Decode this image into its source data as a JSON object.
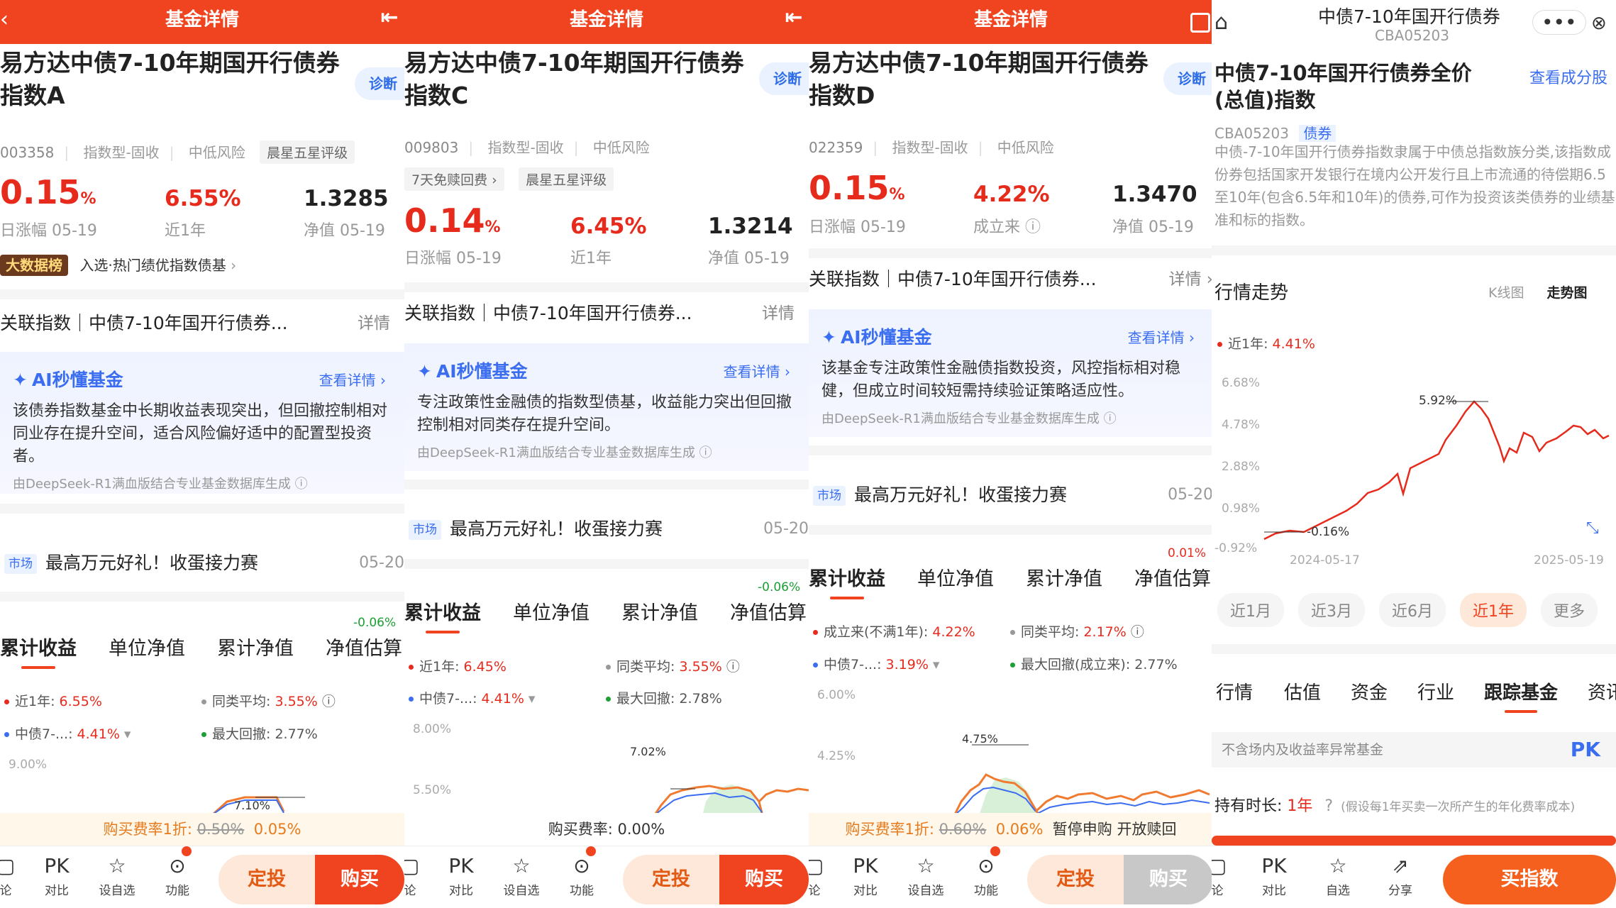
{
  "panels": [
    {
      "header": "基金详情",
      "fund_title": "易方达中债7-10年期国开行债券指数A",
      "diag": "诊断",
      "code": "003358",
      "type": "指数型-固收",
      "risk": "中低风险",
      "rating": "晨星五星评级",
      "daily_change": "0.15",
      "daily_label": "日涨幅 05-19",
      "ret": "6.55%",
      "ret_label": "近1年",
      "nav": "1.3285",
      "nav_label": "净值 05-19",
      "bigdata_badge": "大数据榜",
      "bigdata_text": "入选·热门绩优指数债基",
      "rel_index": "关联指数｜中债7-10年国开行债券...",
      "rel_detail": "详情",
      "ai_title": "AI秒懂基金",
      "ai_more": "查看详情 ›",
      "ai_text": "该债券指数基金中长期收益表现突出，但回撤控制相对同业存在提升空间，适合风险偏好适中的配置型投资者。",
      "ai_src": "由DeepSeek-R1满血版结合专业基金数据库生成 ⓘ",
      "mkt_badge": "市场",
      "mkt_text": "最高万元好礼！收蛋接力赛",
      "mkt_date": "05-20",
      "tabs": [
        "累计收益",
        "单位净值",
        "累计净值",
        "净值估算"
      ],
      "est_change": "-0.06%",
      "leg1": "近1年: ",
      "leg1v": "6.55%",
      "leg2": "同类平均: ",
      "leg2v": "3.55%",
      "leg3": "中债7-...: ",
      "leg3v": "4.41%",
      "leg4": "最大回撤: ",
      "leg4v": "2.77%",
      "ytop": "9.00%",
      "peak": "7.10%",
      "fee_label": "购买费率1折: ",
      "fee_old": "0.50%",
      "fee_new": "0.05%",
      "foot": [
        "论",
        "对比",
        "设自选",
        "功能"
      ],
      "btn1": "定投",
      "btn2": "购买"
    },
    {
      "header": "基金详情",
      "fund_title": "易方达中债7-10年期国开行债券指数C",
      "diag": "诊断",
      "code": "009803",
      "type": "指数型-固收",
      "risk": "中低风险",
      "tag1": "7天免赎回费 ›",
      "rating": "晨星五星评级",
      "daily_change": "0.14",
      "daily_label": "日涨幅 05-19",
      "ret": "6.45%",
      "ret_label": "近1年",
      "nav": "1.3214",
      "nav_label": "净值 05-19",
      "rel_index": "关联指数｜中债7-10年国开行债券...",
      "rel_detail": "详情",
      "ai_title": "AI秒懂基金",
      "ai_more": "查看详情 ›",
      "ai_text": "专注政策性金融债的指数型债基，收益能力突出但回撤控制相对同类存在提升空间。",
      "ai_src": "由DeepSeek-R1满血版结合专业基金数据库生成 ⓘ",
      "mkt_badge": "市场",
      "mkt_text": "最高万元好礼！收蛋接力赛",
      "mkt_date": "05-20",
      "tabs": [
        "累计收益",
        "单位净值",
        "累计净值",
        "净值估算"
      ],
      "est_change": "-0.06%",
      "leg1": "近1年: ",
      "leg1v": "6.45%",
      "leg2": "同类平均: ",
      "leg2v": "3.55%",
      "leg3": "中债7-...: ",
      "leg3v": "4.41%",
      "leg4": "最大回撤: ",
      "leg4v": "2.78%",
      "ytop": "8.00%",
      "ymid": "5.50%",
      "peak": "7.02%",
      "fee_text": "购买费率: 0.00%",
      "foot": [
        "论",
        "对比",
        "设自选",
        "功能"
      ],
      "btn1": "定投",
      "btn2": "购买"
    },
    {
      "header": "基金详情",
      "fund_title": "易方达中债7-10年期国开行债券指数D",
      "diag": "诊断",
      "code": "022359",
      "type": "指数型-固收",
      "risk": "中低风险",
      "daily_change": "0.15",
      "daily_label": "日涨幅 05-19",
      "ret": "4.22%",
      "ret_label": "成立来 ⓘ",
      "nav": "1.3470",
      "nav_label": "净值 05-19",
      "rel_index": "关联指数｜中债7-10年国开行债券...",
      "rel_detail": "详情 ›",
      "ai_title": "AI秒懂基金",
      "ai_more": "查看详情 ›",
      "ai_text": "该基金专注政策性金融债指数投资，风控指标相对稳健，但成立时间较短需持续验证策略适应性。",
      "ai_src": "由DeepSeek-R1满血版结合专业基金数据库生成 ⓘ",
      "mkt_badge": "市场",
      "mkt_text": "最高万元好礼！收蛋接力赛",
      "mkt_date": "05-20",
      "tabs": [
        "累计收益",
        "单位净值",
        "累计净值",
        "净值估算"
      ],
      "est_change": "0.01%",
      "leg1": "成立来(不满1年): ",
      "leg1v": "4.22%",
      "leg2": "同类平均: ",
      "leg2v": "2.17%",
      "leg3": "中债7-...: ",
      "leg3v": "3.19%",
      "leg4": "最大回撤(成立来): ",
      "leg4v": "2.77%",
      "ytop": "6.00%",
      "ymid": "4.25%",
      "peak": "4.75%",
      "fee_label": "购买费率1折: ",
      "fee_old": "0.60%",
      "fee_new": "0.06%",
      "fee_extra": "暂停申购 开放赎回",
      "foot": [
        "论",
        "对比",
        "设自选",
        "功能"
      ],
      "btn1": "定投",
      "btn2": "购买"
    }
  ],
  "index_panel": {
    "top_title": "中债7-10年国开行债券",
    "top_code": "CBA05203",
    "name": "中债7-10年国开行债券全价(总值)指数",
    "view_components": "查看成分股",
    "code": "CBA05203",
    "tag": "债券",
    "desc": "中债-7-10年国开行债券指数隶属于中债总指数族分类,该指数成份券包括国家开发银行在境内公开发行且上市流通的待偿期6.5至10年(包含6.5年和10年)的债券,可作为投资该类债券的业绩基准和标的指数。",
    "trend_title": "行情走势",
    "kline": "K线图",
    "trend": "走势图",
    "legend": "近1年: ",
    "legend_v": "4.41%",
    "y_ticks": [
      "6.68%",
      "4.78%",
      "2.88%",
      "0.98%",
      "-0.92%"
    ],
    "x_start": "2024-05-17",
    "x_end": "2025-05-19",
    "max_label": "5.92%",
    "min_label": "-0.16%",
    "ranges": [
      "近1月",
      "近3月",
      "近6月",
      "近1年",
      "更多"
    ],
    "sub_tabs": [
      "行情",
      "估值",
      "资金",
      "行业",
      "跟踪基金",
      "资讯"
    ],
    "filter": "不含场内及收益率异常基金",
    "pk": "PK",
    "hold_label": "持有时长: ",
    "hold_value": "1年",
    "hold_note": "(假设每1年买卖一次所产生的年化费率成本)",
    "foot": [
      "论",
      "对比",
      "自选",
      "分享"
    ],
    "buy": "买指数"
  },
  "colors": {
    "brand": "#f0431f",
    "up": "#e62b1d",
    "blue": "#3a6df0"
  }
}
